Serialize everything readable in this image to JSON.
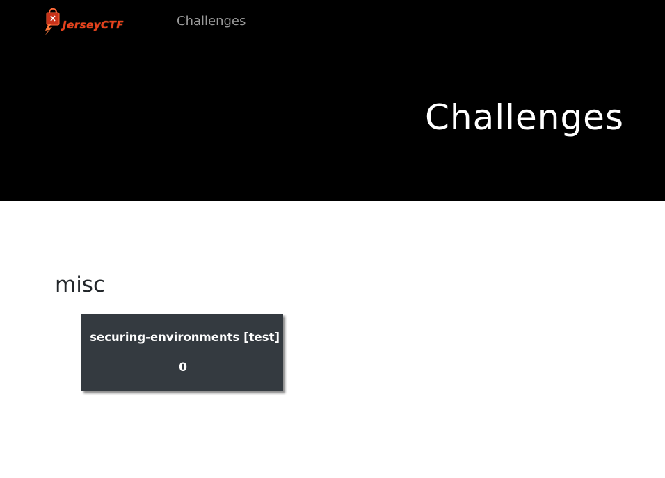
{
  "nav": {
    "logo_text": "JerseyCTF",
    "links": [
      {
        "label": "Challenges"
      }
    ]
  },
  "header": {
    "title": "Challenges"
  },
  "categories": [
    {
      "name": "misc",
      "challenges": [
        {
          "name": "securing-environments [test]",
          "value": "0"
        }
      ]
    }
  ],
  "colors": {
    "background_header": "#000000",
    "card_background": "#343a40",
    "logo_accent": "#e8401c",
    "nav_link": "#9a9a9a"
  }
}
